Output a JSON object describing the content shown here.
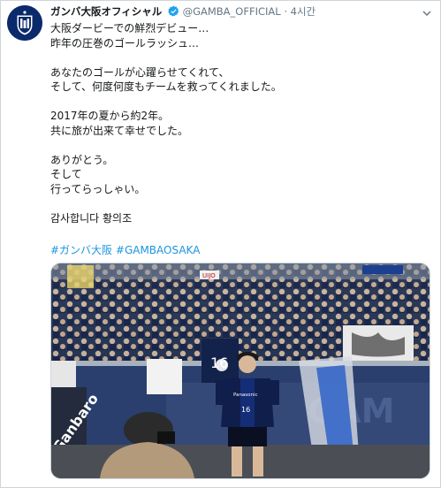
{
  "tweet": {
    "display_name": "ガンバ大阪オフィシャル",
    "handle": "@GAMBA_OFFICIAL",
    "separator": "·",
    "time": "4시간",
    "lines": [
      "大阪ダービーでの鮮烈デビュー…",
      "昨年の圧巻のゴールラッシュ…",
      "",
      "あなたのゴールが心躍らせてくれて、",
      "そして、何度何度もチームを救ってくれました。",
      "",
      "2017年の夏から約2年。",
      "共に旅が出来て幸せでした。",
      "",
      "ありがとう。",
      "そして",
      "行ってらっしゃい。",
      "",
      "감사합니다 황의조"
    ],
    "hashtags": [
      "#ガンバ大阪",
      "#GAMBAOSAKA"
    ]
  },
  "photo": {
    "player_number": "16",
    "shirt_sponsor": "Panasonic",
    "banner_text": "UIJO",
    "towel_text": "Ganbaro",
    "flag_number": "16"
  },
  "colors": {
    "link": "#1b95e0",
    "verified": "#1da1f2",
    "secondary_text": "#657786",
    "gamba_blue": "#0b2a6b"
  }
}
